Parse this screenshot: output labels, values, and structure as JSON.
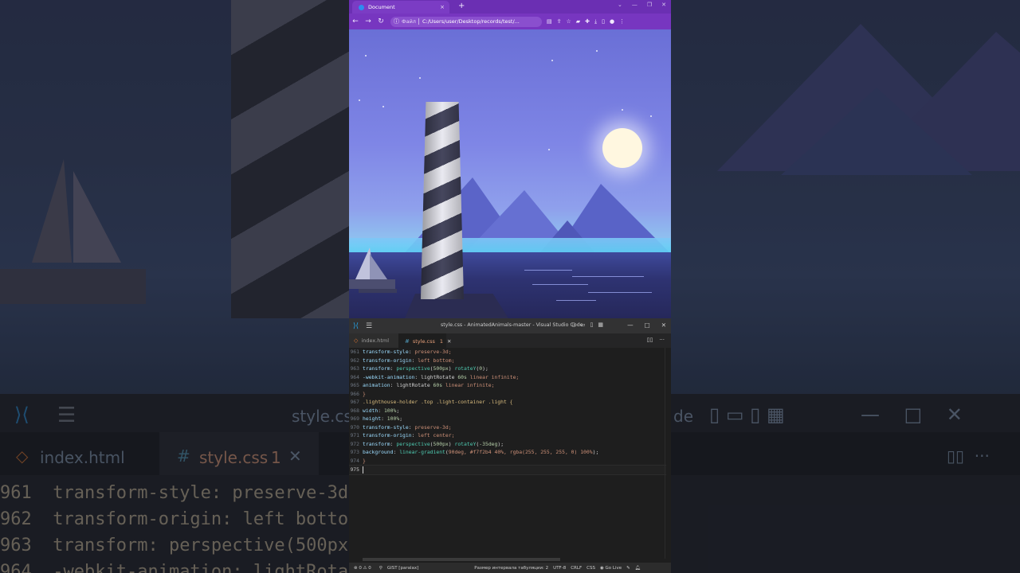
{
  "browser": {
    "tab_title": "Document",
    "tab_close": "×",
    "new_tab": "+",
    "address_scheme": "Файл",
    "address_url": "C:/Users/user/Desktop/records/test/..."
  },
  "vscode": {
    "window_title": "style.css - AnimatedAnimals-master - Visual Studio Code",
    "tabs": [
      {
        "label": "index.html"
      },
      {
        "label": "style.css",
        "badge": "1"
      }
    ],
    "lines": [
      {
        "n": "961",
        "prop": "transform-style",
        "val": "preserve-3d;"
      },
      {
        "n": "962",
        "prop": "transform-origin",
        "val": "left bottom;"
      },
      {
        "n": "963",
        "prop": "transform",
        "fn": "perspective",
        "arg": "500px",
        "fn2": "rotateY",
        "arg2": "0",
        "tail": ";"
      },
      {
        "n": "964",
        "prop": "-webkit-animation",
        "val": "lightRotate",
        "num": "60s",
        "rest": "linear infinite;"
      },
      {
        "n": "965",
        "prop": "animation",
        "val": "lightRotate",
        "num": "60s",
        "rest": "linear infinite;"
      },
      {
        "n": "966",
        "text": "}"
      },
      {
        "n": "967",
        "text": ".lighthouse-holder .top .light-container .light {"
      },
      {
        "n": "968",
        "prop": "width",
        "num": "100%",
        "tail": ";"
      },
      {
        "n": "969",
        "prop": "height",
        "num": "100%",
        "tail": ";"
      },
      {
        "n": "970",
        "prop": "transform-style",
        "val": "preserve-3d;"
      },
      {
        "n": "971",
        "prop": "transform-origin",
        "val": "left center;"
      },
      {
        "n": "972",
        "prop": "transform",
        "fn": "perspective",
        "arg": "500px",
        "fn2": "rotateY",
        "arg2": "-35deg",
        "tail": ";"
      },
      {
        "n": "973",
        "prop": "background",
        "fn": "linear-gradient",
        "args": "90deg, #f7f2b4 40%, rgba(255, 255, 255, 0) 100%",
        "tail": ";"
      },
      {
        "n": "974",
        "text": "}"
      },
      {
        "n": "975",
        "text": ""
      }
    ],
    "status": {
      "problems": "⊗ 0 ⚠ 0",
      "gist": "GIST [paralax]",
      "indent": "Размер интервала табуляции: 2",
      "encoding": "UTF-8",
      "eol": "CRLF",
      "language": "CSS",
      "golive": "Go Live"
    }
  },
  "background": {
    "tab_label": "index.html",
    "tab_active": "style.css",
    "tab_badge": "1",
    "title_fragment": "style.css",
    "title_fragment2": "de",
    "code_lines": [
      {
        "n": "961",
        "text": "transform-style: preserve-3d"
      },
      {
        "n": "962",
        "text": "transform-origin: left botto"
      },
      {
        "n": "963",
        "text": "transform: perspective(500px"
      },
      {
        "n": "964",
        "text": "-webkit-animation: lightRota"
      }
    ]
  }
}
